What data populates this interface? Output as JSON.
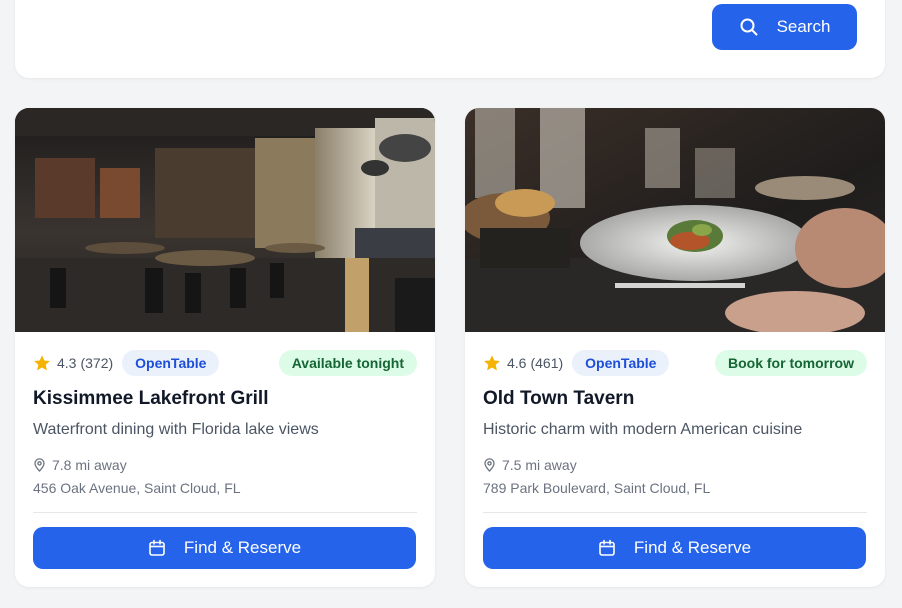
{
  "search": {
    "button_label": "Search",
    "icon": "search-icon"
  },
  "colors": {
    "primary": "#2563eb",
    "provider_badge_bg": "#eaf1fb",
    "availability_badge_bg": "#dcfce7",
    "star": "#f5b301"
  },
  "restaurants": [
    {
      "image": "restaurant-interior-photo",
      "rating": "4.3",
      "review_count": "(372)",
      "provider": "OpenTable",
      "availability": "Available tonight",
      "name": "Kissimmee Lakefront Grill",
      "description": "Waterfront dining with Florida lake views",
      "distance": "7.8 mi away",
      "address": "456 Oak Avenue, Saint Cloud, FL",
      "action_label": "Find & Reserve"
    },
    {
      "image": "plated-dish-photo",
      "rating": "4.6",
      "review_count": "(461)",
      "provider": "OpenTable",
      "availability": "Book for tomorrow",
      "name": "Old Town Tavern",
      "description": "Historic charm with modern American cuisine",
      "distance": "7.5 mi away",
      "address": "789 Park Boulevard, Saint Cloud, FL",
      "action_label": "Find & Reserve"
    }
  ]
}
